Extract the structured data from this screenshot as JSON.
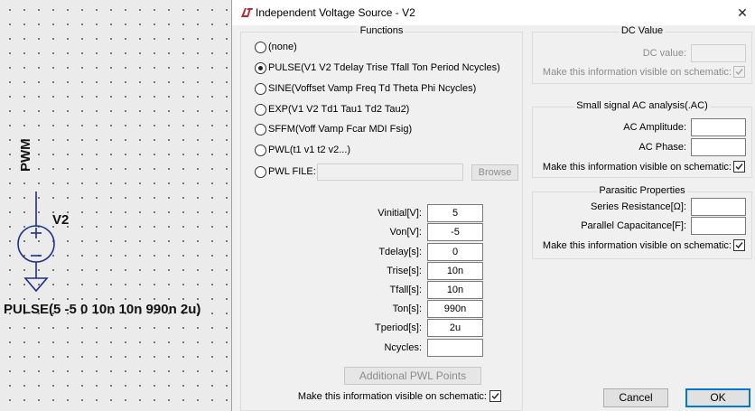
{
  "schematic": {
    "net_label": "PWM",
    "component_name": "V2",
    "component_value": "PULSE(5 -5 0 10n 10n 990n 2u)"
  },
  "dialog": {
    "title": "Independent Voltage Source - V2",
    "app_icon": "ltspice-logo-icon",
    "close_symbol": "✕"
  },
  "functions": {
    "title": "Functions",
    "options": [
      {
        "label": "(none)",
        "checked": false
      },
      {
        "label": "PULSE(V1 V2 Tdelay Trise Tfall Ton Period Ncycles)",
        "checked": true
      },
      {
        "label": "SINE(Voffset Vamp Freq Td Theta Phi Ncycles)",
        "checked": false
      },
      {
        "label": "EXP(V1 V2 Td1 Tau1 Td2 Tau2)",
        "checked": false
      },
      {
        "label": "SFFM(Voff Vamp Fcar MDI Fsig)",
        "checked": false
      },
      {
        "label": "PWL(t1 v1 t2 v2...)",
        "checked": false
      },
      {
        "label": "PWL FILE:",
        "checked": false
      }
    ],
    "pwl_file_value": "",
    "browse_label": "Browse",
    "params": [
      {
        "label": "Vinitial[V]:",
        "value": "5"
      },
      {
        "label": "Von[V]:",
        "value": "-5"
      },
      {
        "label": "Tdelay[s]:",
        "value": "0"
      },
      {
        "label": "Trise[s]:",
        "value": "10n"
      },
      {
        "label": "Tfall[s]:",
        "value": "10n"
      },
      {
        "label": "Ton[s]:",
        "value": "990n"
      },
      {
        "label": "Tperiod[s]:",
        "value": "2u"
      },
      {
        "label": "Ncycles:",
        "value": ""
      }
    ],
    "additional_pwl_label": "Additional PWL Points",
    "visible_label": "Make this information visible on schematic:",
    "visible_checked": true
  },
  "dc": {
    "title": "DC Value",
    "value_label": "DC value:",
    "value": "",
    "visible_label": "Make this information visible on schematic:",
    "visible_checked": true
  },
  "ac": {
    "title": "Small signal AC analysis(.AC)",
    "amplitude_label": "AC Amplitude:",
    "amplitude_value": "",
    "phase_label": "AC Phase:",
    "phase_value": "",
    "visible_label": "Make this information visible on schematic:",
    "visible_checked": true
  },
  "parasitic": {
    "title": "Parasitic Properties",
    "resistance_label": "Series Resistance[Ω]:",
    "resistance_value": "",
    "capacitance_label": "Parallel Capacitance[F]:",
    "capacitance_value": "",
    "visible_label": "Make this information visible on schematic:",
    "visible_checked": true
  },
  "buttons": {
    "cancel": "Cancel",
    "ok": "OK"
  }
}
